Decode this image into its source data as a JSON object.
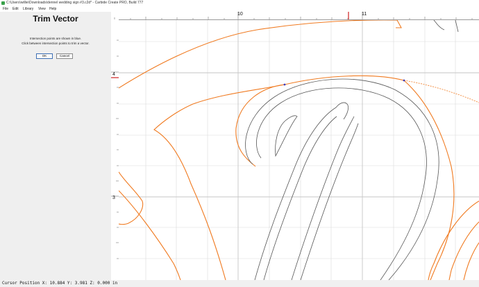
{
  "window": {
    "title": "C:\\Users\\willie\\Downloads\\dennel wedding sign #3.c2d* - Carbide Create PRO, Build 777"
  },
  "menu": {
    "file": "File",
    "edit": "Edit",
    "library": "Library",
    "view": "View",
    "help": "Help"
  },
  "panel": {
    "title": "Trim Vector",
    "line1": "Intersection points are shown in blue.",
    "line2": "Click between intersection points to trim a vector.",
    "ok_label": "OK",
    "cancel_label": "Cancel"
  },
  "rulers": {
    "top_labels": [
      "10",
      "11"
    ],
    "left_labels": [
      "4",
      "3"
    ]
  },
  "status": {
    "text": "Cursor Position X: 10.884 Y: 3.981 Z: 0.000 in"
  },
  "colors": {
    "vector_orange": "#f07a20",
    "inner_outline": "#555555",
    "intersection_blue": "#3b3bbf",
    "cursor_red": "#d02020",
    "grid": "#dcdcdc"
  }
}
